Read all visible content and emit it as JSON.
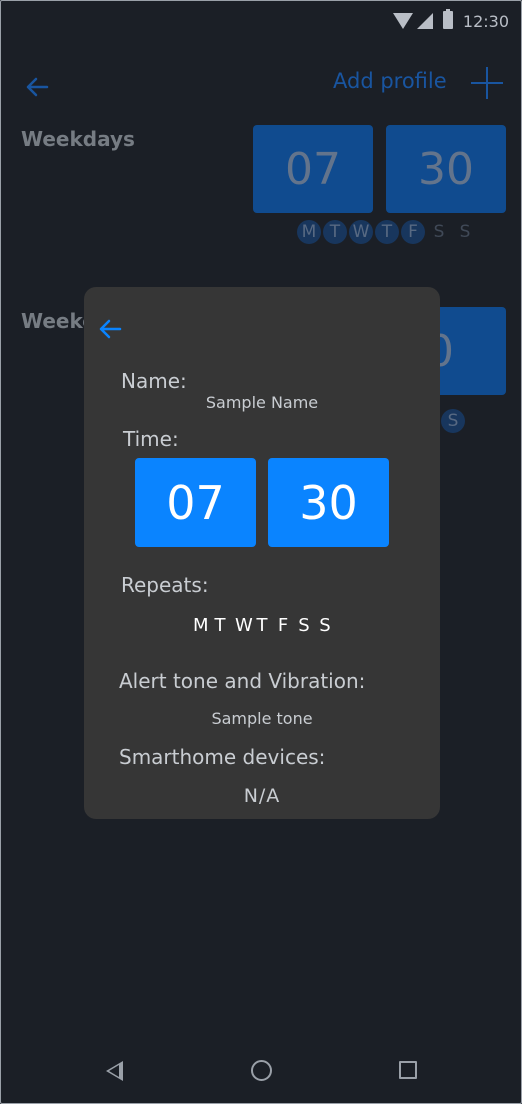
{
  "status_bar": {
    "time": "12:30"
  },
  "header": {
    "add_profile_label": "Add profile"
  },
  "profiles": [
    {
      "label": "Weekdays",
      "hour": "07",
      "minute": "30",
      "days": [
        {
          "letter": "M",
          "active": true
        },
        {
          "letter": "T",
          "active": true
        },
        {
          "letter": "W",
          "active": true
        },
        {
          "letter": "T",
          "active": true
        },
        {
          "letter": "F",
          "active": true
        },
        {
          "letter": "S",
          "active": false
        },
        {
          "letter": "S",
          "active": false
        }
      ]
    },
    {
      "label": "Weeke",
      "minute": "0",
      "days": [
        {
          "letter": "S",
          "active": true
        }
      ]
    }
  ],
  "dialog": {
    "name_label": "Name:",
    "name_value": "Sample Name",
    "time_label": "Time:",
    "hour": "07",
    "minute": "30",
    "repeats_label": "Repeats:",
    "repeat_days": [
      "M",
      "T",
      "W",
      "T",
      "F",
      "S",
      "S"
    ],
    "alert_label": "Alert tone and Vibration:",
    "alert_value": "Sample tone",
    "smarthome_label": "Smarthome devices:",
    "smarthome_value": "N/A"
  },
  "colors": {
    "background": "#1b1f26",
    "accent": "#0a84ff",
    "dialog": "#363636"
  },
  "icons": [
    "back-arrow-icon",
    "plus-icon",
    "wifi-icon",
    "signal-icon",
    "battery-icon",
    "nav-back-icon",
    "nav-home-icon",
    "nav-recents-icon"
  ]
}
